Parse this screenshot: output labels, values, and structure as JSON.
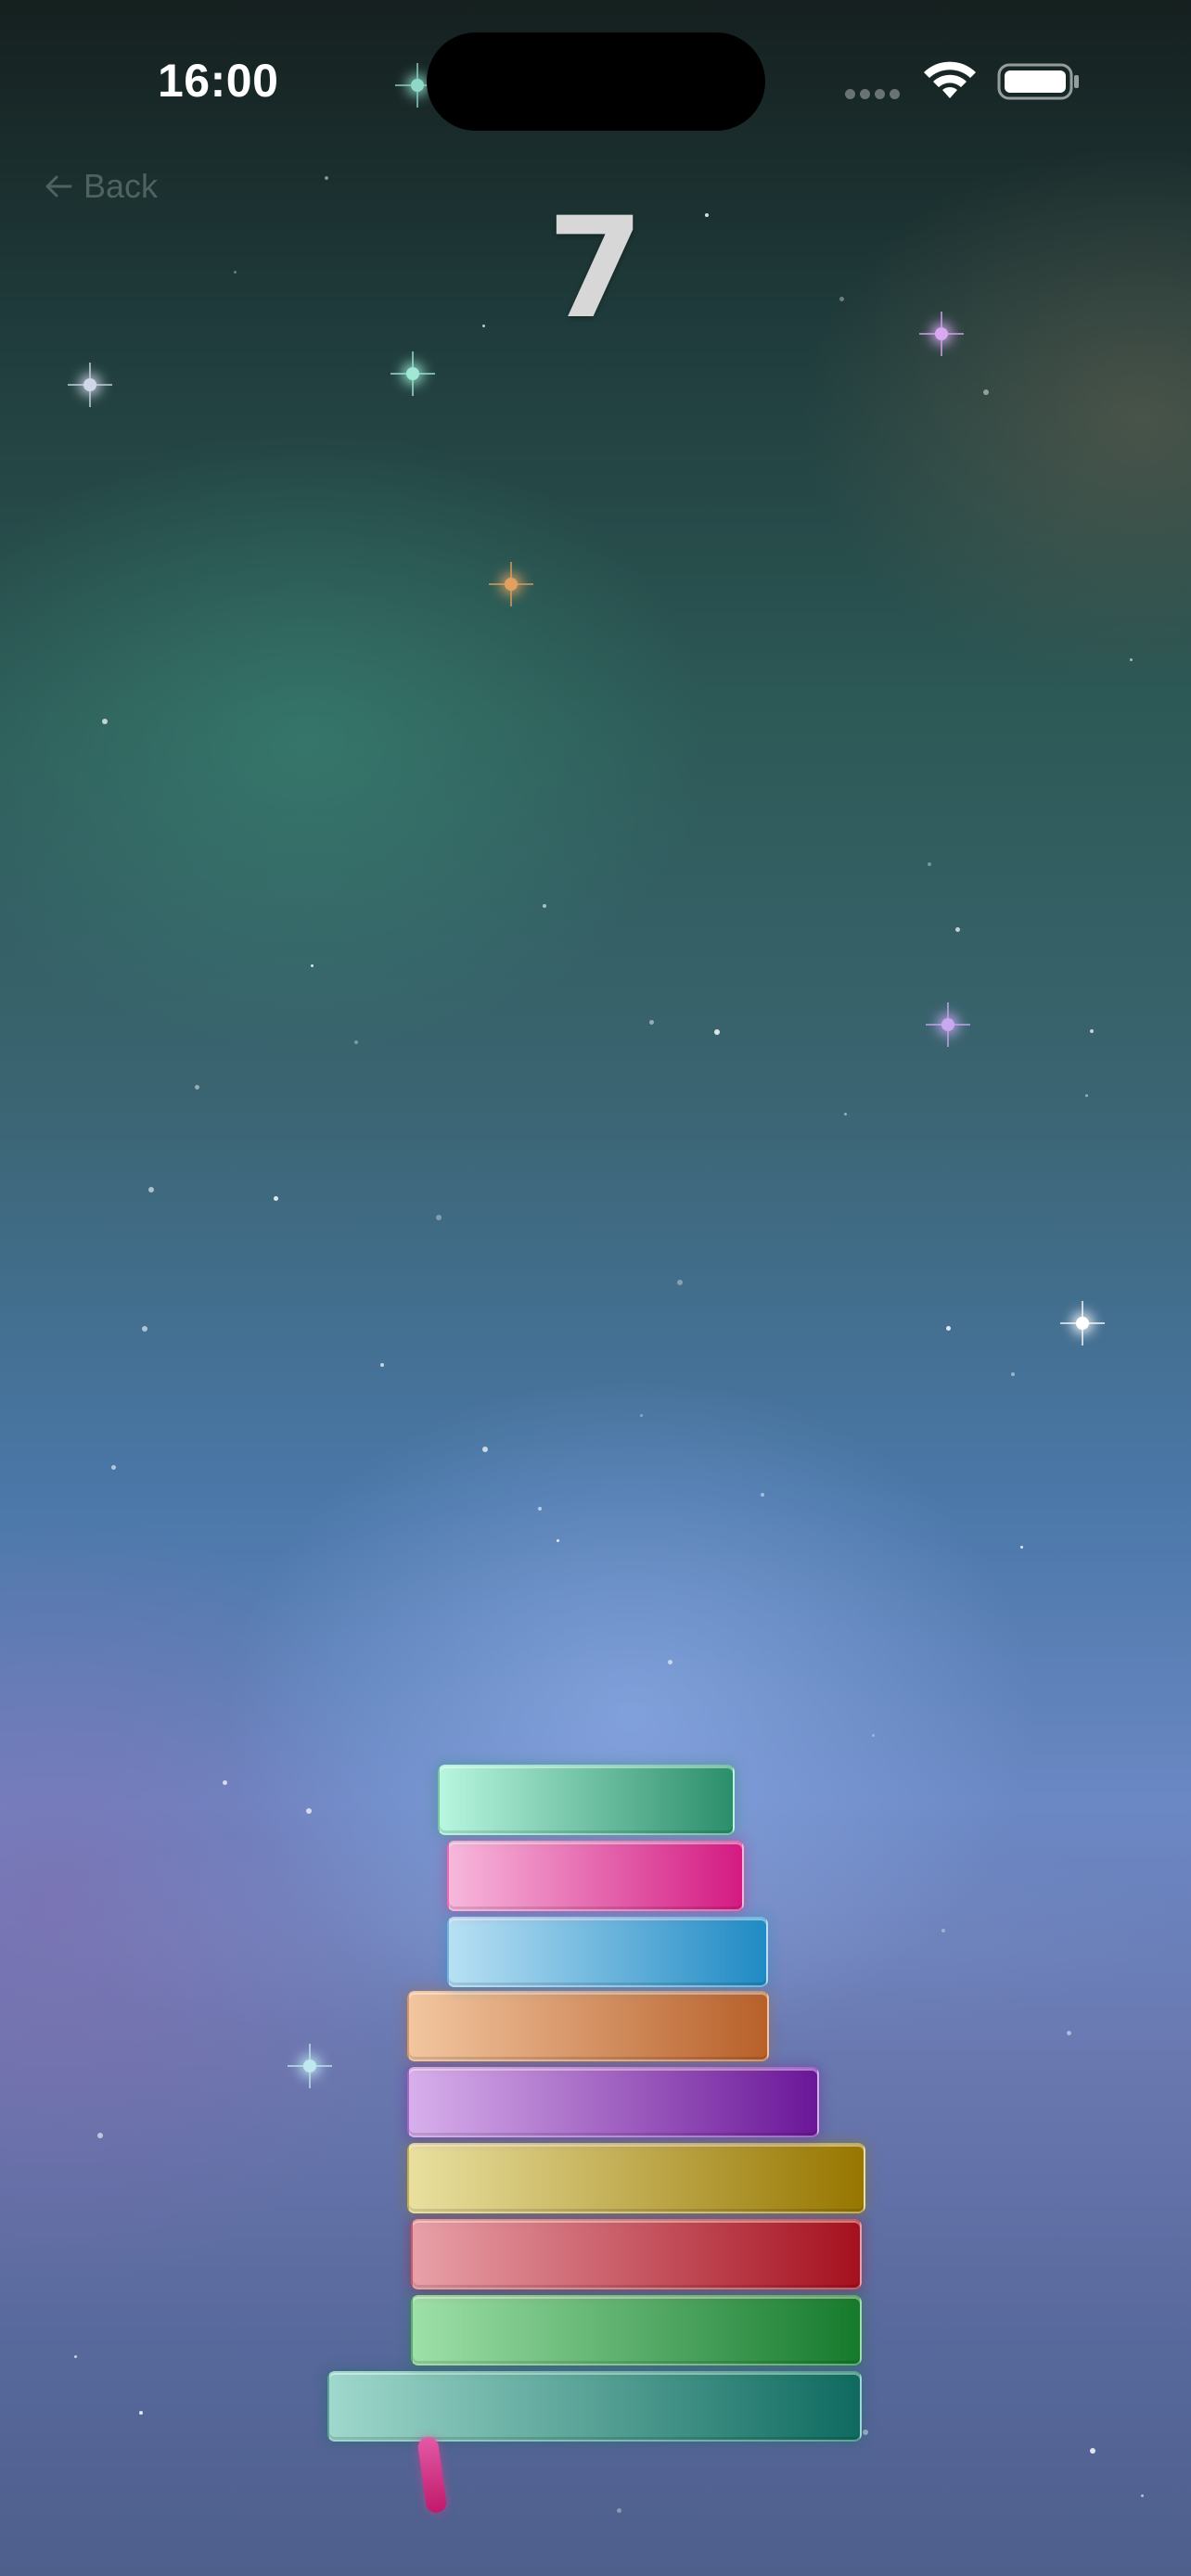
{
  "status_bar": {
    "time": "16:00"
  },
  "navigation": {
    "back_label": "Back"
  },
  "game": {
    "score": "7",
    "stack_blocks": [
      {
        "name": "block-teal-base",
        "color_light": "#9fd8cc",
        "color_dark": "#0f6a5f"
      },
      {
        "name": "block-green",
        "color_light": "#9ee0a8",
        "color_dark": "#157a2c"
      },
      {
        "name": "block-red",
        "color_light": "#e8a0a8",
        "color_dark": "#a5101e"
      },
      {
        "name": "block-yellow",
        "color_light": "#e9e0a0",
        "color_dark": "#977600"
      },
      {
        "name": "block-purple",
        "color_light": "#d8b0ec",
        "color_dark": "#6a1698"
      },
      {
        "name": "block-orange",
        "color_light": "#f2c6a0",
        "color_dark": "#b8602a"
      },
      {
        "name": "block-blue",
        "color_light": "#b8e0f4",
        "color_dark": "#1f8ac4"
      },
      {
        "name": "block-pink",
        "color_light": "#f7b8dc",
        "color_dark": "#d41a82"
      },
      {
        "name": "block-mint-top",
        "color_light": "#b8f6e0",
        "color_dark": "#2b8e6a"
      }
    ]
  },
  "colors": {
    "score_text": "#d7d7d7",
    "back_text": "#78908c",
    "dropping_pin": "#c2186b"
  }
}
